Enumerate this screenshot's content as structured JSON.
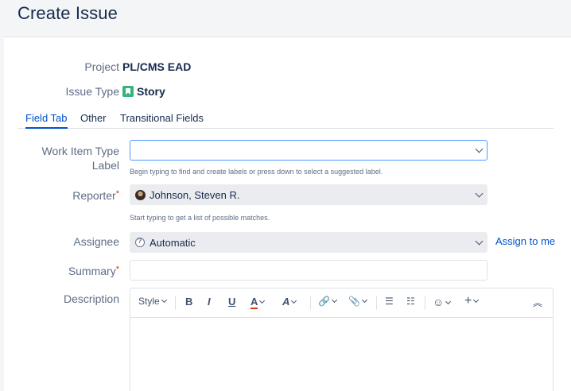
{
  "header": {
    "title": "Create Issue"
  },
  "form": {
    "project": {
      "label": "Project",
      "value": "PL/CMS EAD"
    },
    "issue_type": {
      "label": "Issue Type",
      "value": "Story"
    },
    "tabs": [
      {
        "label": "Field Tab",
        "active": true
      },
      {
        "label": "Other",
        "active": false
      },
      {
        "label": "Transitional Fields",
        "active": false
      }
    ],
    "work_item_type_label": {
      "label_line1": "Work Item Type",
      "label_line2": "Label",
      "value": "",
      "help": "Begin typing to find and create labels or press down to select a suggested label."
    },
    "reporter": {
      "label": "Reporter",
      "required_mark": "*",
      "value": "Johnson, Steven R.",
      "help": "Start typing to get a list of possible matches."
    },
    "assignee": {
      "label": "Assignee",
      "value": "Automatic",
      "assign_to_me": "Assign to me"
    },
    "summary": {
      "label": "Summary",
      "required_mark": "*",
      "value": ""
    },
    "description": {
      "label": "Description",
      "toolbar": {
        "style": "Style",
        "bold": "B",
        "italic": "I",
        "underline": "U",
        "text_color": "A",
        "more_formatting": "A",
        "link": "🔗",
        "attachment": "📎",
        "bullet_list": "☰",
        "numbered_list": "☷",
        "emoji": "☺",
        "insert": "+",
        "collapse": "︽"
      }
    }
  },
  "colors": {
    "accent": "#0052cc",
    "required": "#de350b",
    "story_icon": "#36b37e"
  }
}
